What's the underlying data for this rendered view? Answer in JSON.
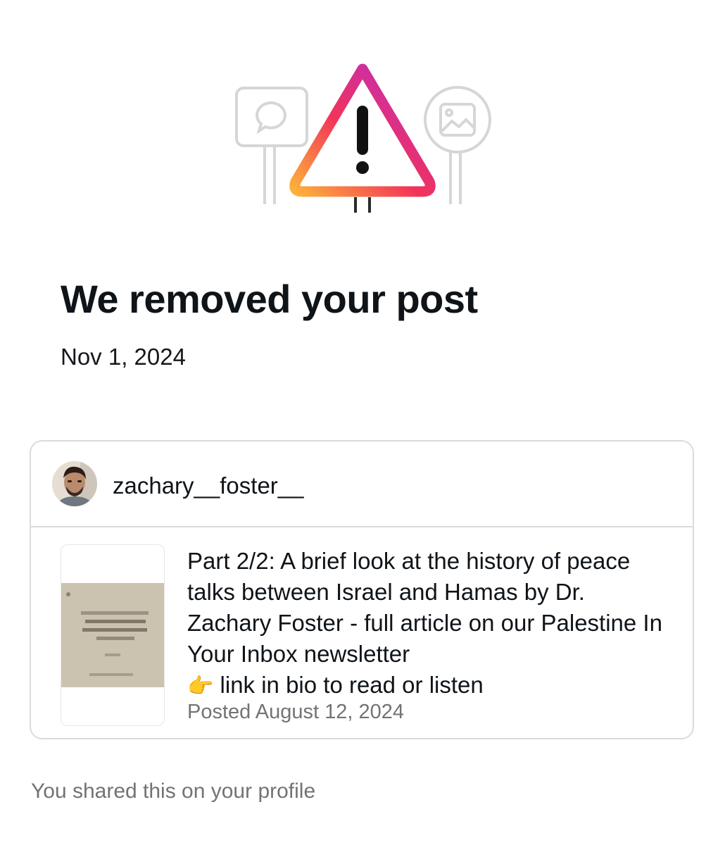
{
  "notice": {
    "icon": "warning-triangle-illustration",
    "title": "We removed your post",
    "date": "Nov 1, 2024"
  },
  "post": {
    "author": {
      "username": "zachary__foster__",
      "avatar_icon": "profile-photo"
    },
    "thumbnail_icon": "newsletter-preview-image",
    "caption_text": "Part 2/2: A brief look at the history of peace talks between Israel and Hamas by Dr. Zachary Foster - full article on our Palestine In Your Inbox newsletter",
    "caption_pointer": "👉",
    "caption_tail": "link in bio to read or listen",
    "posted": "Posted August 12, 2024"
  },
  "footer": {
    "note": "You shared this on your profile"
  },
  "colors": {
    "gradient": [
      "#f9ce34",
      "#ee2a7b",
      "#6228d7"
    ],
    "muted": "#737373",
    "border": "#dbdbdb"
  }
}
